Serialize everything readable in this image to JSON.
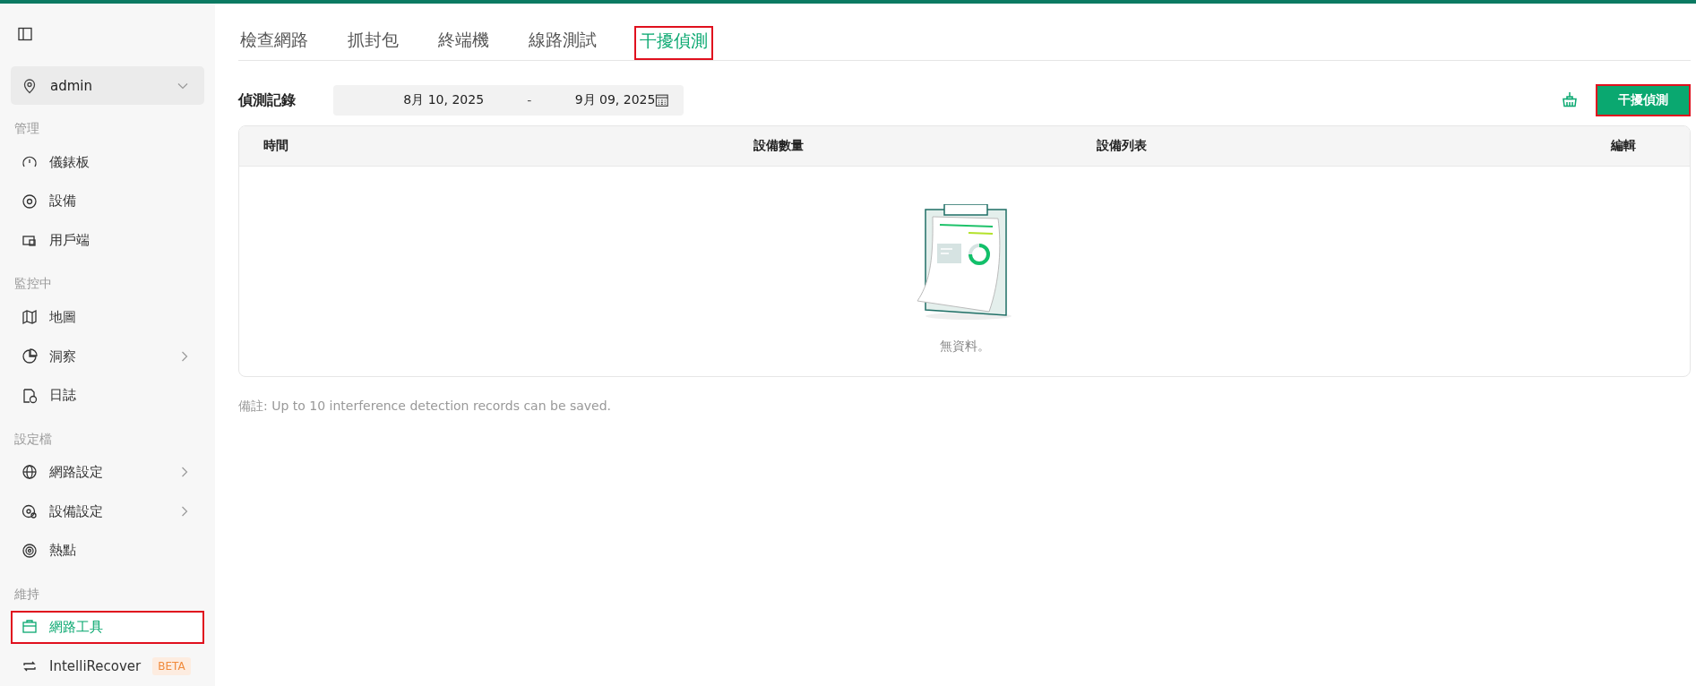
{
  "sidebar": {
    "site_selector": {
      "value": "admin"
    },
    "sections": [
      {
        "title": "管理",
        "items": [
          {
            "label": "儀錶板",
            "selected": false,
            "expandable": false
          },
          {
            "label": "設備",
            "selected": false,
            "expandable": false
          },
          {
            "label": "用戶端",
            "selected": false,
            "expandable": false
          }
        ]
      },
      {
        "title": "監控中",
        "items": [
          {
            "label": "地圖",
            "selected": false,
            "expandable": false
          },
          {
            "label": "洞察",
            "selected": false,
            "expandable": true
          },
          {
            "label": "日誌",
            "selected": false,
            "expandable": false
          }
        ]
      },
      {
        "title": "設定檔",
        "items": [
          {
            "label": "網路設定",
            "selected": false,
            "expandable": true
          },
          {
            "label": "設備設定",
            "selected": false,
            "expandable": true
          },
          {
            "label": "熱點",
            "selected": false,
            "expandable": false
          }
        ]
      },
      {
        "title": "維持",
        "items": [
          {
            "label": "網路工具",
            "selected": true,
            "expandable": false,
            "highlighted": true
          },
          {
            "label": "IntelliRecover",
            "selected": false,
            "expandable": false,
            "badge": "BETA"
          }
        ]
      }
    ]
  },
  "tabs": [
    {
      "label": "檢查網路",
      "selected": false
    },
    {
      "label": "抓封包",
      "selected": false
    },
    {
      "label": "終端機",
      "selected": false
    },
    {
      "label": "線路測試",
      "selected": false
    },
    {
      "label": "干擾偵測",
      "selected": true,
      "highlighted": true
    }
  ],
  "records": {
    "label": "偵測記錄",
    "date_from": "8月 10, 2025",
    "date_separator": "-",
    "date_to": "9月 09, 2025"
  },
  "start_button": {
    "label": "干擾偵測",
    "highlighted": true
  },
  "table": {
    "columns": [
      "時間",
      "設備數量",
      "設備列表",
      "編輯"
    ],
    "empty_text": "無資料。"
  },
  "note": "備註: Up to 10 interference detection records can be saved."
}
